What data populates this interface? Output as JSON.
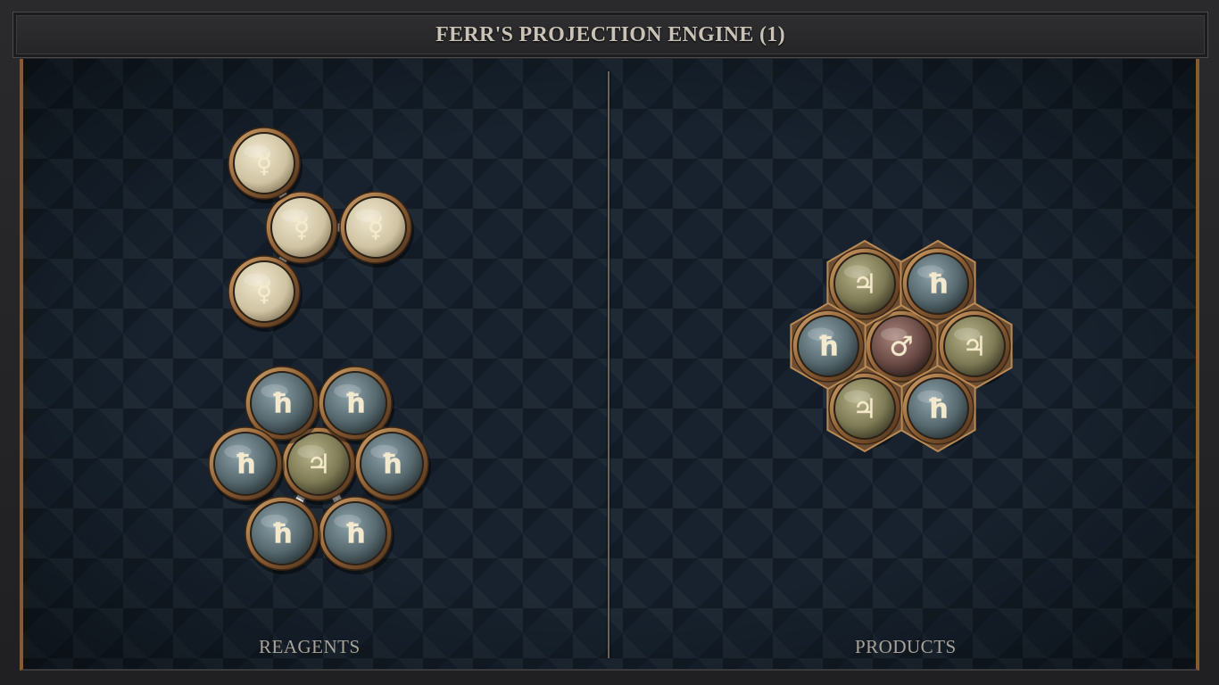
{
  "window": {
    "title": "FERR'S PROJECTION ENGINE (1)"
  },
  "panels": {
    "reagents_label": "REAGENTS",
    "products_label": "PRODUCTS"
  },
  "glyphs": {
    "mercury": "☿",
    "lead": "ħ",
    "tin": "♃",
    "iron": "♂"
  },
  "colors": {
    "mercury_atom": "#d8cfb4",
    "lead_atom": "#5f7680",
    "tin_atom": "#8c8a62",
    "iron_atom": "#6e4d48",
    "bezel": "#9a6a3c",
    "symbol": "#f3e9cf"
  },
  "molecules": [
    {
      "name": "reagent-mercury-molecule",
      "panel": "reagents",
      "atoms": [
        "mercury",
        "mercury",
        "mercury",
        "mercury"
      ]
    },
    {
      "name": "reagent-lead-tin-molecule",
      "panel": "reagents",
      "atoms": [
        "tin",
        "lead",
        "lead",
        "lead",
        "lead",
        "lead",
        "lead"
      ]
    },
    {
      "name": "product-iron-molecule",
      "panel": "products",
      "atoms": [
        "iron",
        "tin",
        "lead",
        "tin",
        "lead",
        "tin",
        "lead"
      ]
    }
  ]
}
